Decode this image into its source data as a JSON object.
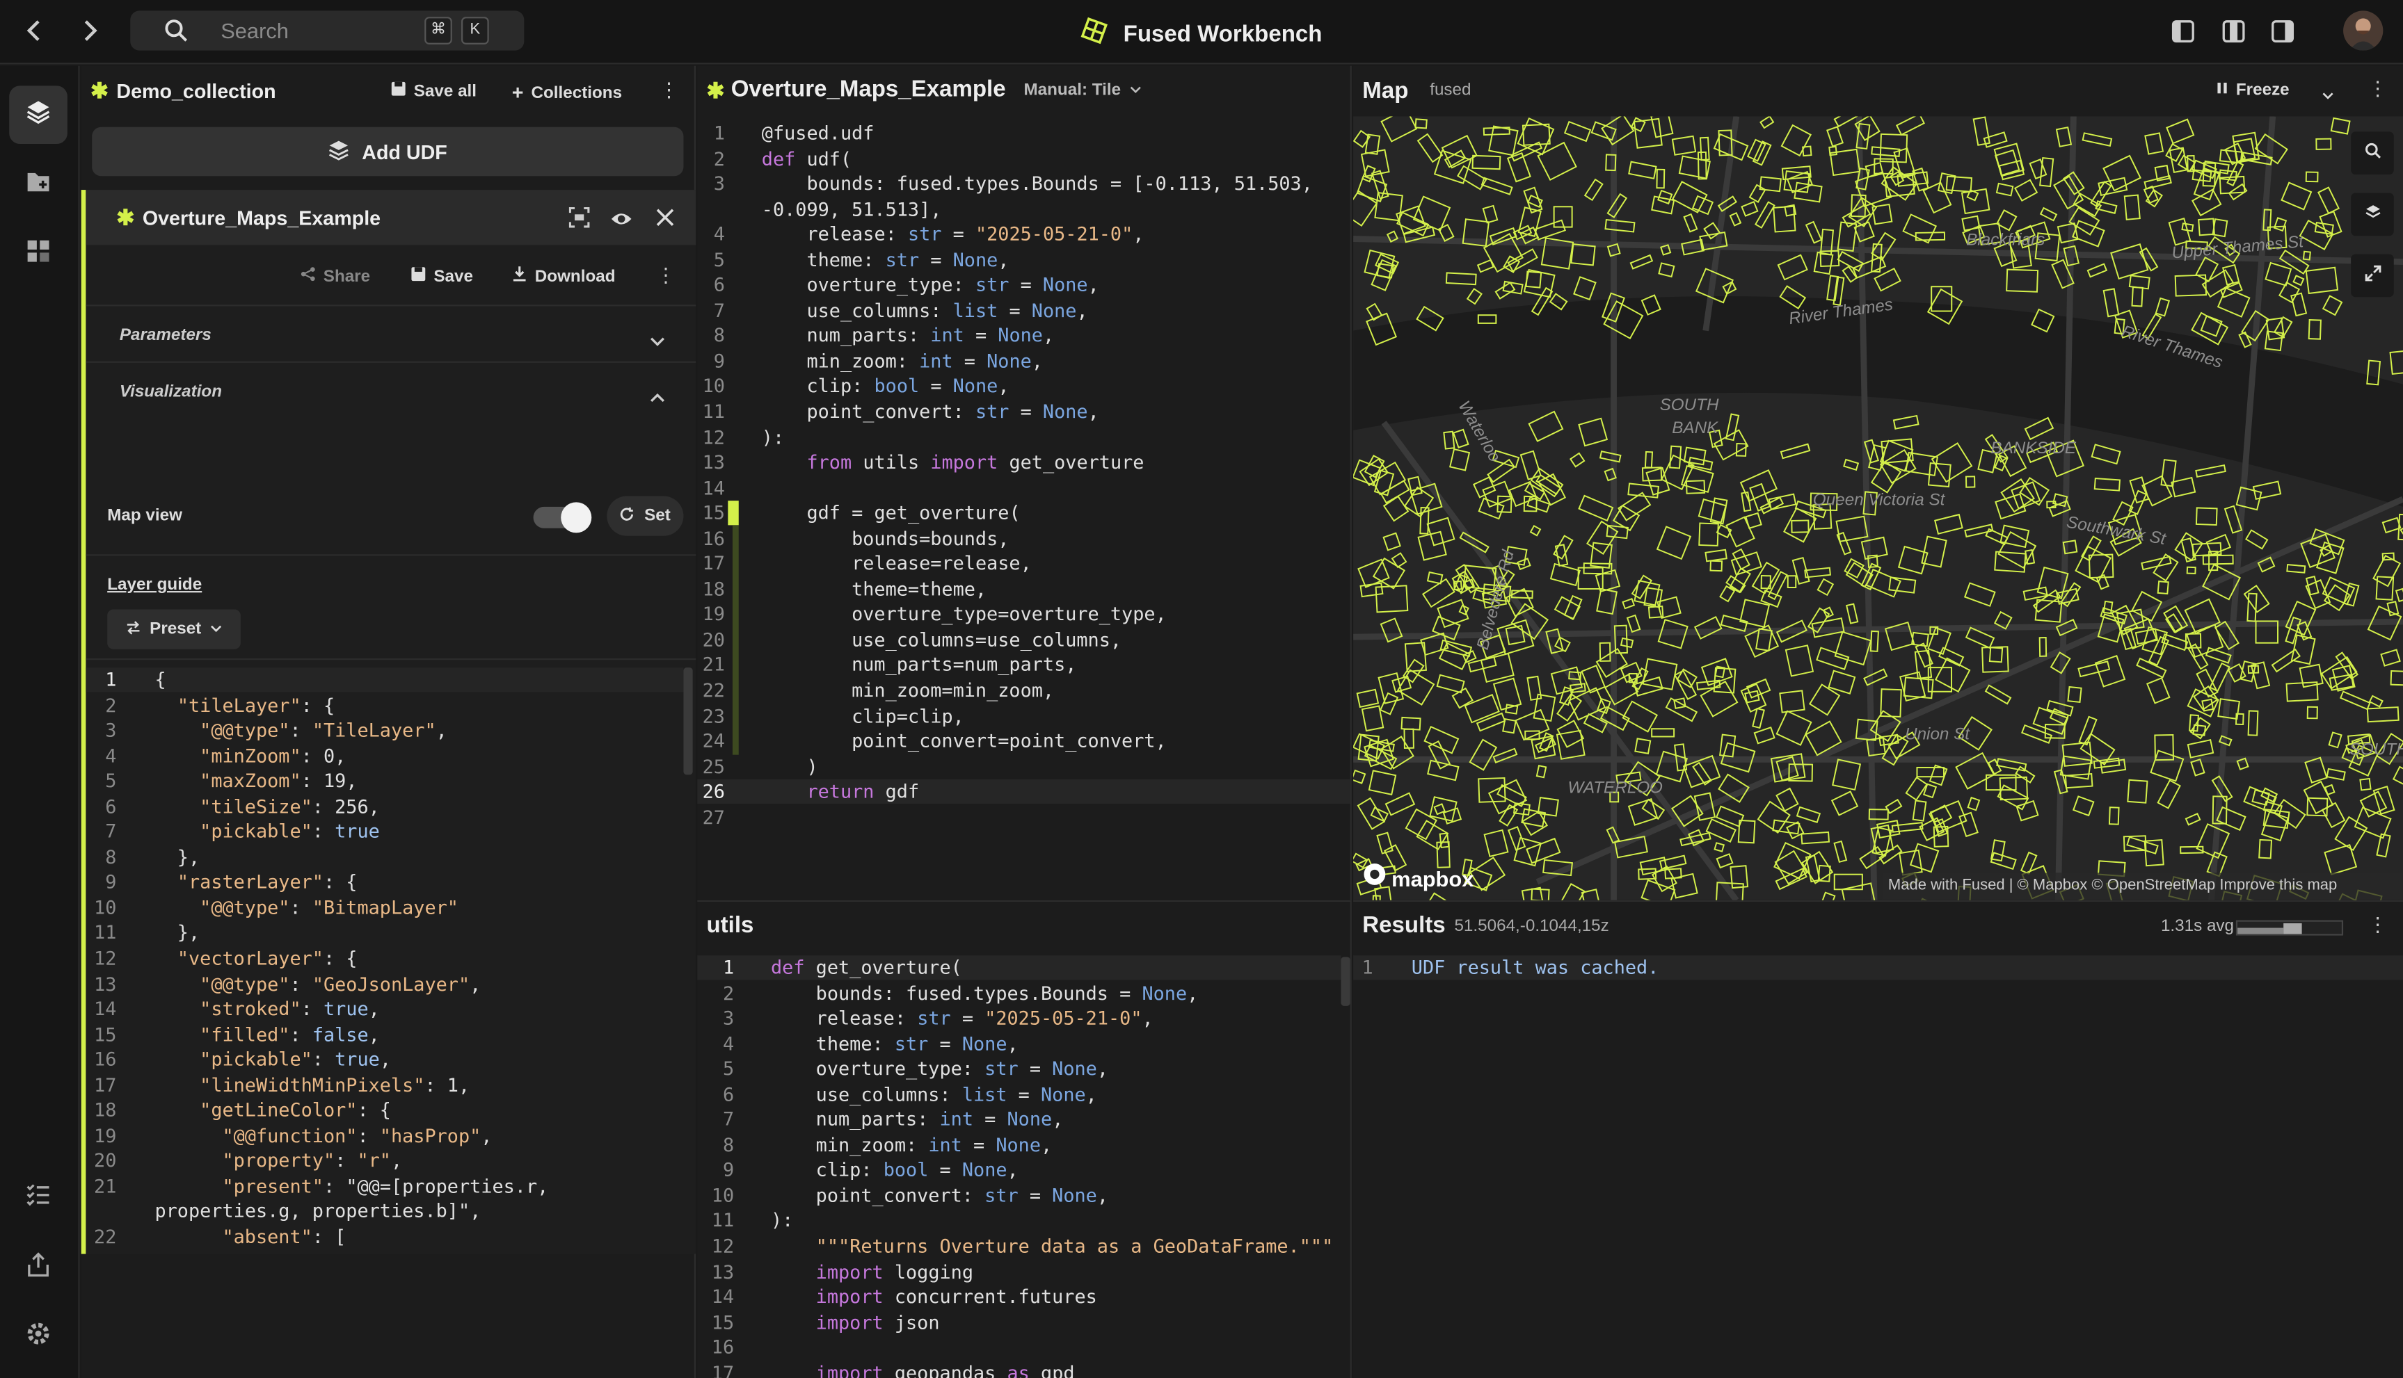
{
  "app": {
    "title": "Fused Workbench"
  },
  "topbar": {
    "search_placeholder": "Search",
    "kbd_cmd": "⌘",
    "kbd_k": "K"
  },
  "collection": {
    "name": "Demo_collection",
    "save_all": "Save all",
    "collections": "Collections",
    "add_udf": "Add UDF"
  },
  "udf_card": {
    "name": "Overture_Maps_Example",
    "share": "Share",
    "save": "Save",
    "download": "Download",
    "parameters": "Parameters",
    "visualization": "Visualization",
    "map_view": "Map view",
    "map_view_on": true,
    "set": "Set",
    "layer_guide": "Layer guide",
    "preset": "Preset"
  },
  "layer_json": [
    {
      "n": "1",
      "t": "{"
    },
    {
      "n": "2",
      "t": "  \"tileLayer\": {"
    },
    {
      "n": "3",
      "t": "    \"@@type\": \"TileLayer\","
    },
    {
      "n": "4",
      "t": "    \"minZoom\": 0,"
    },
    {
      "n": "5",
      "t": "    \"maxZoom\": 19,"
    },
    {
      "n": "6",
      "t": "    \"tileSize\": 256,"
    },
    {
      "n": "7",
      "t": "    \"pickable\": true"
    },
    {
      "n": "8",
      "t": "  },"
    },
    {
      "n": "9",
      "t": "  \"rasterLayer\": {"
    },
    {
      "n": "10",
      "t": "    \"@@type\": \"BitmapLayer\""
    },
    {
      "n": "11",
      "t": "  },"
    },
    {
      "n": "12",
      "t": "  \"vectorLayer\": {"
    },
    {
      "n": "13",
      "t": "    \"@@type\": \"GeoJsonLayer\","
    },
    {
      "n": "14",
      "t": "    \"stroked\": true,"
    },
    {
      "n": "15",
      "t": "    \"filled\": false,"
    },
    {
      "n": "16",
      "t": "    \"pickable\": true,"
    },
    {
      "n": "17",
      "t": "    \"lineWidthMinPixels\": 1,"
    },
    {
      "n": "18",
      "t": "    \"getLineColor\": {"
    },
    {
      "n": "19",
      "t": "      \"@@function\": \"hasProp\","
    },
    {
      "n": "20",
      "t": "      \"property\": \"r\","
    },
    {
      "n": "21",
      "t": "      \"present\": \"@@=[properties.r,"
    },
    {
      "n": "",
      "t": "properties.g, properties.b]\","
    },
    {
      "n": "22",
      "t": "      \"absent\": ["
    }
  ],
  "editor": {
    "name": "Overture_Maps_Example",
    "mode": "Manual: Tile",
    "lines": [
      {
        "n": "1",
        "t": "@fused.udf"
      },
      {
        "n": "2",
        "t": "def udf("
      },
      {
        "n": "3",
        "t": "    bounds: fused.types.Bounds = [-0.113, 51.503,"
      },
      {
        "n": "",
        "t": "-0.099, 51.513],"
      },
      {
        "n": "4",
        "t": "    release: str = \"2025-05-21-0\","
      },
      {
        "n": "5",
        "t": "    theme: str = None,"
      },
      {
        "n": "6",
        "t": "    overture_type: str = None,"
      },
      {
        "n": "7",
        "t": "    use_columns: list = None,"
      },
      {
        "n": "8",
        "t": "    num_parts: int = None,"
      },
      {
        "n": "9",
        "t": "    min_zoom: int = None,"
      },
      {
        "n": "10",
        "t": "    clip: bool = None,"
      },
      {
        "n": "11",
        "t": "    point_convert: str = None,"
      },
      {
        "n": "12",
        "t": "):"
      },
      {
        "n": "13",
        "t": "    from utils import get_overture"
      },
      {
        "n": "14",
        "t": ""
      },
      {
        "n": "15",
        "t": "    gdf = get_overture("
      },
      {
        "n": "16",
        "t": "        bounds=bounds,"
      },
      {
        "n": "17",
        "t": "        release=release,"
      },
      {
        "n": "18",
        "t": "        theme=theme,"
      },
      {
        "n": "19",
        "t": "        overture_type=overture_type,"
      },
      {
        "n": "20",
        "t": "        use_columns=use_columns,"
      },
      {
        "n": "21",
        "t": "        num_parts=num_parts,"
      },
      {
        "n": "22",
        "t": "        min_zoom=min_zoom,"
      },
      {
        "n": "23",
        "t": "        clip=clip,"
      },
      {
        "n": "24",
        "t": "        point_convert=point_convert,"
      },
      {
        "n": "25",
        "t": "    )"
      },
      {
        "n": "26",
        "t": "    return gdf"
      },
      {
        "n": "27",
        "t": ""
      }
    ]
  },
  "utils": {
    "title": "utils",
    "lines": [
      {
        "n": "1",
        "t": "def get_overture("
      },
      {
        "n": "2",
        "t": "    bounds: fused.types.Bounds = None,"
      },
      {
        "n": "3",
        "t": "    release: str = \"2025-05-21-0\","
      },
      {
        "n": "4",
        "t": "    theme: str = None,"
      },
      {
        "n": "5",
        "t": "    overture_type: str = None,"
      },
      {
        "n": "6",
        "t": "    use_columns: list = None,"
      },
      {
        "n": "7",
        "t": "    num_parts: int = None,"
      },
      {
        "n": "8",
        "t": "    min_zoom: int = None,"
      },
      {
        "n": "9",
        "t": "    clip: bool = None,"
      },
      {
        "n": "10",
        "t": "    point_convert: str = None,"
      },
      {
        "n": "11",
        "t": "):"
      },
      {
        "n": "12",
        "t": "    \"\"\"Returns Overture data as a GeoDataFrame.\"\"\""
      },
      {
        "n": "13",
        "t": "    import logging"
      },
      {
        "n": "14",
        "t": "    import concurrent.futures"
      },
      {
        "n": "15",
        "t": "    import json"
      },
      {
        "n": "16",
        "t": ""
      },
      {
        "n": "17",
        "t": "    import geopandas as gpd"
      }
    ]
  },
  "map": {
    "title": "Map",
    "basemap": "fused",
    "freeze": "Freeze",
    "labels": [
      "River Thames",
      "River Thames",
      "SOUTH",
      "BANK",
      "BANKSIDE",
      "Waterloo",
      "Upper Thames St",
      "WATERLOO",
      "SOUTHWARK",
      "Belvedere Rd",
      "Southwark St",
      "Union St",
      "Blackfriars",
      "Queen Victoria St"
    ],
    "attribution": "Made with Fused | © Mapbox © OpenStreetMap Improve this map",
    "logo": "mapbox",
    "line_color": "#d4f04a"
  },
  "results": {
    "title": "Results",
    "coords": "51.5064,-0.1044,15z",
    "avg": "1.31s avg",
    "lines": [
      {
        "n": "1",
        "t": "UDF result was cached."
      }
    ]
  }
}
